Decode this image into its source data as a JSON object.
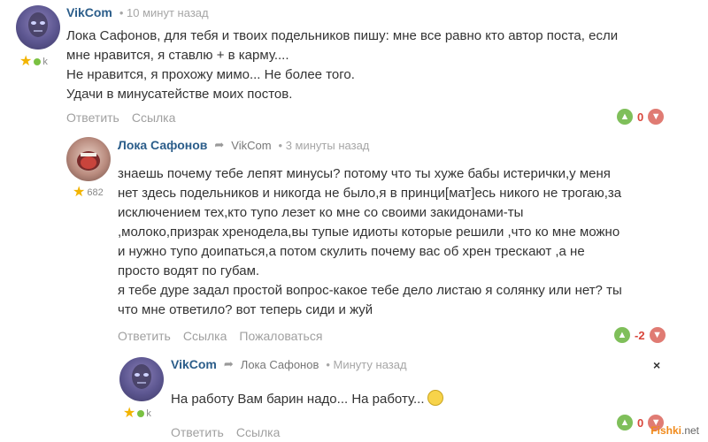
{
  "comments": [
    {
      "author": "VikCom",
      "time": "• 10 минут назад",
      "rank_suffix": "k",
      "lines": [
        "Лока Сафонов, для тебя и твоих подельников пишу: мне все равно кто автор поста, если",
        "мне нравится, я ставлю + в карму....",
        "Не нравится, я прохожу мимо... Не более того.",
        "Удачи в минусатействе моих постов."
      ],
      "actions": [
        "Ответить",
        "Ссылка"
      ],
      "score": "0"
    },
    {
      "author": "Лока Сафонов",
      "reply_to": "VikCom",
      "time": "• 3 минуты назад",
      "rank_value": "682",
      "lines": [
        "знаешь почему тебе лепят минусы? потому что ты хуже бабы истерички,у меня",
        "нет здесь подельников и никогда не было,я в принци[мат]есь никого не трогаю,за",
        "исключением тех,кто тупо лезет ко мне со своими закидонами-ты",
        ",молоко,призрак хренодела,вы тупые идиоты которые решили ,что ко мне можно",
        "и нужно тупо доипаться,а потом скулить почему вас об хрен трескают ,а не",
        "просто водят по губам.",
        "я тебе дуре задал простой вопрос-какое тебе дело листаю я солянку или нет? ты",
        "что мне ответило? вот теперь сиди и жуй"
      ],
      "actions": [
        "Ответить",
        "Ссылка",
        "Пожаловаться"
      ],
      "score": "-2"
    },
    {
      "author": "VikCom",
      "reply_to": "Лока Сафонов",
      "time": "• Минуту назад",
      "rank_suffix": "k",
      "text": "На работу Вам барин надо... На работу...",
      "actions": [
        "Ответить",
        "Ссылка"
      ],
      "score": "0",
      "close": "×"
    }
  ],
  "icons": {
    "reply_arrow": "➦",
    "star": "★",
    "up": "👍",
    "down": "👎"
  },
  "watermark": {
    "brand": "Fishki",
    "suffix": ".net"
  }
}
